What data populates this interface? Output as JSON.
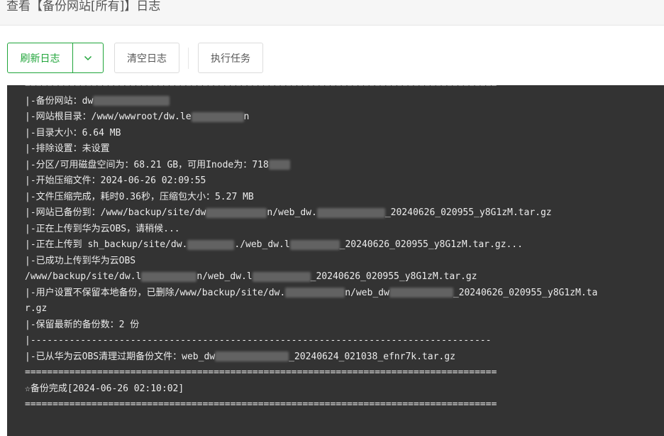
{
  "header": {
    "title": "查看【备份网站[所有]】日志"
  },
  "toolbar": {
    "refresh_label": "刷新日志",
    "clear_label": "清空日志",
    "run_label": "执行任务"
  },
  "colors": {
    "accent": "#20a53a",
    "console_bg": "#333333",
    "console_text": "#ececec"
  },
  "icons": {
    "dropdown": "chevron-down-icon"
  },
  "log": {
    "line0": "=====================================================================================",
    "line1": "|-备份网站：dw",
    "line2a": "|-网站根目录：/www/wwwroot/dw.le",
    "line2b": "n",
    "line3": "|-目录大小：6.64 MB",
    "line4": "|-排除设置：未设置",
    "line5": "|-分区/可用磁盘空间为：68.21 GB，可用Inode为：718",
    "line6": "|-开始压缩文件：2024-06-26 02:09:55",
    "line7": "|-文件压缩完成，耗时0.36秒，压缩包大小：5.27 MB",
    "line8a": "|-网站已备份到：/www/backup/site/dw",
    "line8b": "n/web_dw.",
    "line8c": "_20240626_020955_y8G1zM.tar.gz",
    "line9": "|-正在上传到华为云OBS，请稍候...",
    "line10a": "|-正在上传到 sh_backup/site/dw.",
    "line10b": "./web_dw.l",
    "line10c": "_20240626_020955_y8G1zM.tar.gz...",
    "line11": "|-已成功上传到华为云OBS",
    "line12a": "/www/backup/site/dw.l",
    "line12b": "n/web_dw.l",
    "line12c": "_20240626_020955_y8G1zM.tar.gz",
    "line13a": "|-用户设置不保留本地备份，已删除/www/backup/site/dw.",
    "line13b": "n/web_dw",
    "line13c": "_20240626_020955_y8G1zM.ta",
    "line14": "r.gz",
    "line15": "|-保留最新的备份数：2 份",
    "line16": "|-----------------------------------------------------------------------------------",
    "line17a": "|-已从华为云OBS清理过期备份文件：web_dw",
    "line17b": "_20240624_021038_efnr7k.tar.gz",
    "line18": "=====================================================================================",
    "line19": "☆备份完成[2024-06-26 02:10:02]",
    "line20": "====================================================================================="
  }
}
